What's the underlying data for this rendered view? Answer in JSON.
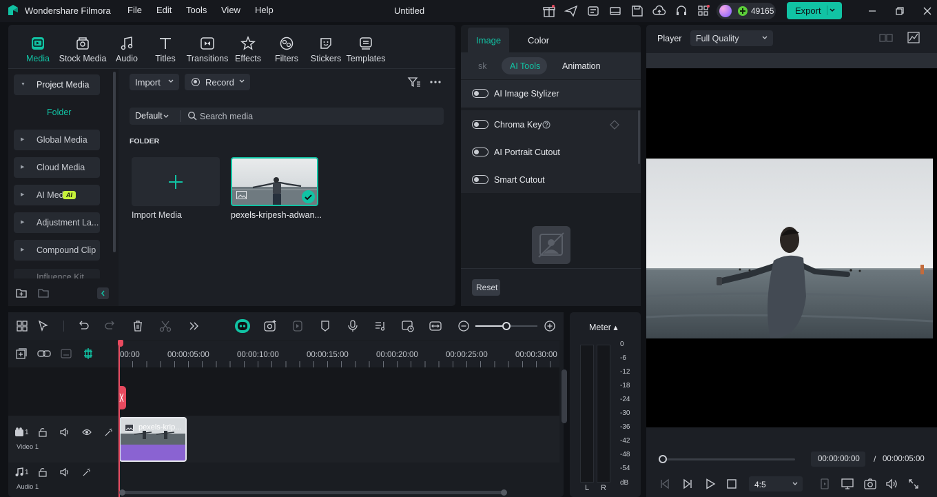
{
  "app": {
    "name": "Wondershare Filmora",
    "doc_title": "Untitled",
    "credits": "49165",
    "export_label": "Export"
  },
  "menu": [
    "File",
    "Edit",
    "Tools",
    "View",
    "Help"
  ],
  "tool_tabs": [
    "Media",
    "Stock Media",
    "Audio",
    "Titles",
    "Transitions",
    "Effects",
    "Filters",
    "Stickers",
    "Templates"
  ],
  "sidebar": {
    "items": [
      "Project Media",
      "Folder",
      "Global Media",
      "Cloud Media",
      "AI Media",
      "Adjustment La...",
      "Compound Clip",
      "Influence Kit"
    ],
    "ai_badge": "AI"
  },
  "media": {
    "import_label": "Import",
    "record_label": "Record",
    "sort_label": "Default",
    "search_placeholder": "Search media",
    "folder_heading": "FOLDER",
    "import_media_label": "Import Media",
    "clip_name": "pexels-kripesh-adwan..."
  },
  "properties": {
    "tabs": [
      "Image",
      "Color"
    ],
    "subtabs": [
      "sk",
      "AI Tools",
      "Animation"
    ],
    "rows": [
      "AI Image Stylizer",
      "Chroma Key",
      "AI Portrait Cutout",
      "Smart Cutout"
    ],
    "reset_label": "Reset"
  },
  "player": {
    "label": "Player",
    "quality": "Full Quality",
    "current_time": "00:00:00:00",
    "separator": "/",
    "total_time": "00:00:05:00",
    "ratio": "4:5",
    "progress": 0
  },
  "timeline": {
    "ruler": [
      "00:00",
      "00:00:05:00",
      "00:00:10:00",
      "00:00:15:00",
      "00:00:20:00",
      "00:00:25:00",
      "00:00:30:00"
    ],
    "video_track": "Video 1",
    "audio_track": "Audio 1",
    "track_num_v": "1",
    "track_num_a": "1",
    "clip_label": "pexels-krip..."
  },
  "meter": {
    "label": "Meter ▴",
    "scale": [
      "0",
      "-6",
      "-12",
      "-18",
      "-24",
      "-30",
      "-36",
      "-42",
      "-48",
      "-54",
      "dB"
    ],
    "left": "L",
    "right": "R"
  },
  "colors": {
    "accent": "#11c3a4",
    "clip": "#8a63d2",
    "playhead": "#e84a5f"
  }
}
